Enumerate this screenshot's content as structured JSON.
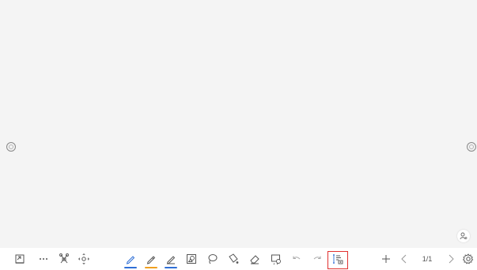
{
  "canvas": {
    "background": "#f4f4f4"
  },
  "toolbar": {
    "tools": [
      {
        "id": "exit",
        "icon": "exit-whiteboard-icon"
      },
      {
        "id": "more",
        "icon": "more-dots-icon"
      },
      {
        "id": "apps",
        "icon": "tools-icon"
      },
      {
        "id": "move",
        "icon": "move-canvas-icon"
      },
      {
        "id": "pen",
        "icon": "pen-icon",
        "underline": "#2f6fd6",
        "active": true
      },
      {
        "id": "highlighter",
        "icon": "highlighter-icon",
        "underline": "#f0a020"
      },
      {
        "id": "brush",
        "icon": "brush-icon",
        "underline": "#2f6fd6"
      },
      {
        "id": "shape",
        "icon": "shape-icon"
      },
      {
        "id": "lasso",
        "icon": "lasso-icon"
      },
      {
        "id": "fill",
        "icon": "fill-bucket-icon"
      },
      {
        "id": "eraser",
        "icon": "eraser-icon"
      },
      {
        "id": "insert",
        "icon": "insert-image-icon"
      },
      {
        "id": "undo",
        "icon": "undo-icon"
      },
      {
        "id": "redo",
        "icon": "redo-icon"
      },
      {
        "id": "screenshot",
        "icon": "screenshot-text-icon",
        "selected": true
      },
      {
        "id": "add-page",
        "icon": "plus-icon"
      },
      {
        "id": "prev-page",
        "icon": "chevron-left-icon"
      },
      {
        "id": "next-page",
        "icon": "chevron-right-icon"
      },
      {
        "id": "settings",
        "icon": "gear-icon"
      }
    ],
    "page_indicator": "1/1"
  },
  "colors": {
    "accent_blue": "#2f6fd6",
    "accent_orange": "#f0a020",
    "selection_red": "#e0312f"
  }
}
